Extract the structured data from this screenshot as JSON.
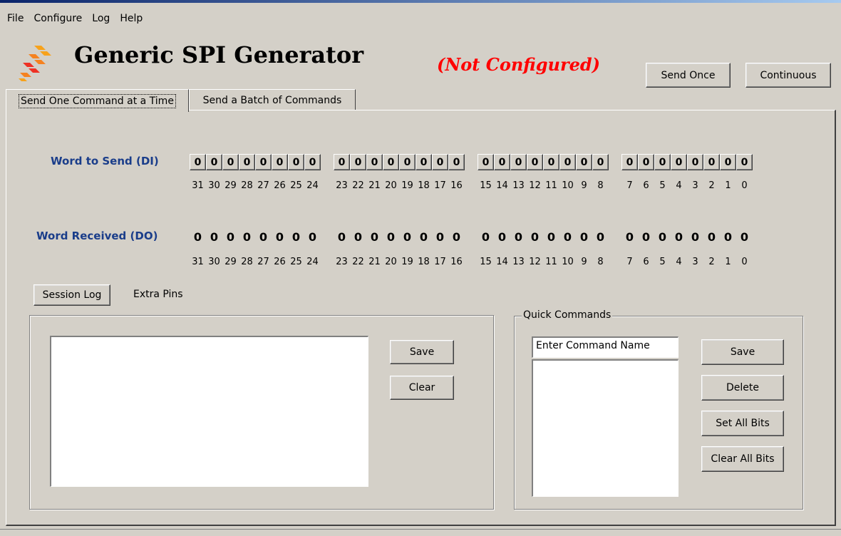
{
  "menu": [
    "File",
    "Configure",
    "Log",
    "Help"
  ],
  "app": {
    "title": "Generic SPI Generator",
    "status": "(Not Configured)",
    "logo_icon": "freescale-logo-icon",
    "accent": "#1a3d8a",
    "status_color": "#ff0000"
  },
  "header_buttons": {
    "send_once": "Send Once",
    "continuous": "Continuous"
  },
  "tabs": [
    {
      "label": "Send One Command at a Time",
      "active": true
    },
    {
      "label": "Send a Batch of Commands",
      "active": false
    }
  ],
  "word_send": {
    "label": "Word to Send (DI)",
    "groups": [
      [
        "0",
        "0",
        "0",
        "0",
        "0",
        "0",
        "0",
        "0"
      ],
      [
        "0",
        "0",
        "0",
        "0",
        "0",
        "0",
        "0",
        "0"
      ],
      [
        "0",
        "0",
        "0",
        "0",
        "0",
        "0",
        "0",
        "0"
      ],
      [
        "0",
        "0",
        "0",
        "0",
        "0",
        "0",
        "0",
        "0"
      ]
    ]
  },
  "word_received": {
    "label": "Word Received (DO)",
    "groups": [
      [
        "0",
        "0",
        "0",
        "0",
        "0",
        "0",
        "0",
        "0"
      ],
      [
        "0",
        "0",
        "0",
        "0",
        "0",
        "0",
        "0",
        "0"
      ],
      [
        "0",
        "0",
        "0",
        "0",
        "0",
        "0",
        "0",
        "0"
      ],
      [
        "0",
        "0",
        "0",
        "0",
        "0",
        "0",
        "0",
        "0"
      ]
    ]
  },
  "bit_numbers": [
    [
      "31",
      "30",
      "29",
      "28",
      "27",
      "26",
      "25",
      "24"
    ],
    [
      "23",
      "22",
      "21",
      "20",
      "19",
      "18",
      "17",
      "16"
    ],
    [
      "15",
      "14",
      "13",
      "12",
      "11",
      "10",
      "9",
      "8"
    ],
    [
      "7",
      "6",
      "5",
      "4",
      "3",
      "2",
      "1",
      "0"
    ]
  ],
  "subtabs": {
    "session_log": "Session Log",
    "extra_pins": "Extra Pins"
  },
  "log": {
    "save": "Save",
    "clear": "Clear"
  },
  "quick_commands": {
    "title": "Quick Commands",
    "name_value": "Enter Command Name",
    "save": "Save",
    "delete": "Delete",
    "set_all": "Set All Bits",
    "clear_all": "Clear All Bits"
  }
}
